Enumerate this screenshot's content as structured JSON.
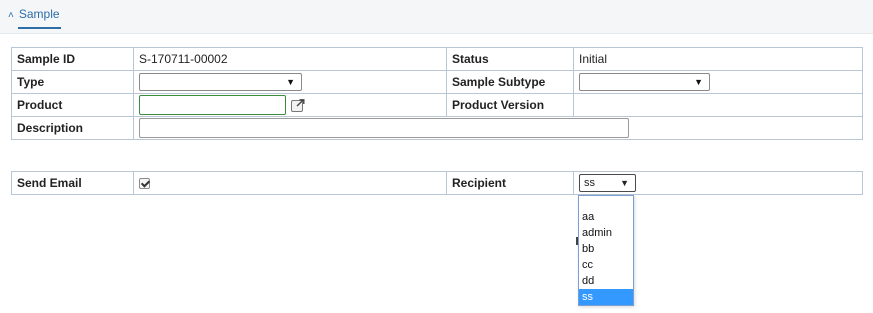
{
  "section": {
    "title": "Sample",
    "chevron": "chevron-up-icon"
  },
  "rows": {
    "sample_id": {
      "label": "Sample ID",
      "value": "S-170711-00002"
    },
    "status": {
      "label": "Status",
      "value": "Initial"
    },
    "type": {
      "label": "Type",
      "value": ""
    },
    "sample_subtype": {
      "label": "Sample Subtype",
      "value": ""
    },
    "product": {
      "label": "Product",
      "value": ""
    },
    "product_version": {
      "label": "Product Version",
      "value": ""
    },
    "description": {
      "label": "Description",
      "value": ""
    },
    "send_email": {
      "label": "Send Email",
      "checked": true
    },
    "recipient": {
      "label": "Recipient",
      "value": "ss"
    }
  },
  "recipient_options": [
    "aa",
    "admin",
    "bb",
    "cc",
    "dd",
    "ss"
  ],
  "recipient_selected_index": 5,
  "colors": {
    "accent": "#2d6ea8",
    "border": "#b8c6d6",
    "selected_option": "#3399ff",
    "product_field_border": "#3c8c3c"
  }
}
